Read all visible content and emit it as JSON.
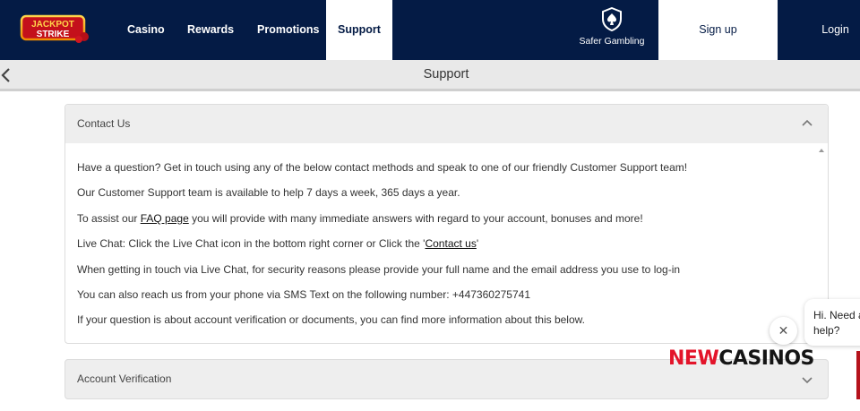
{
  "brand": {
    "logo_text_top": "JACKPOT",
    "logo_text_bottom": "STRIKE"
  },
  "nav": {
    "items": [
      {
        "label": "Casino"
      },
      {
        "label": "Rewards"
      },
      {
        "label": "Promotions"
      },
      {
        "label": "Support"
      }
    ],
    "safer_gambling": "Safer Gambling",
    "signup": "Sign up",
    "login": "Login"
  },
  "page": {
    "title": "Support"
  },
  "contact": {
    "title": "Contact Us",
    "line1": "Have a question? Get in touch using any of the below contact methods and speak to one of our friendly Customer Support team!",
    "line2": "Our Customer Support team is available to help 7 days a week, 365 days a year.",
    "line3_pre": "To assist our ",
    "line3_link": "FAQ page",
    "line3_post": " you will provide with many immediate answers with regard to your account, bonuses and more!",
    "line4_pre": "Live Chat: Click the Live Chat icon in the bottom right corner or Click the '",
    "line4_link": "Contact us",
    "line4_post": "'",
    "line5": "When getting in touch via Live Chat, for security reasons please provide your full name and the email address you use to log-in",
    "line6": "You can also reach us from your phone via SMS Text on the following number: +447360275741",
    "line7": "If your question is about account verification or documents, you can find more information about this below."
  },
  "verification": {
    "title": "Account Verification"
  },
  "chat": {
    "message": "Hi. Need any help?",
    "close_glyph": "✕"
  },
  "watermark": {
    "part1": "NEW",
    "part2": "CASINOS"
  },
  "colors": {
    "nav_bg": "#041b45",
    "accent_red": "#e3142a"
  }
}
